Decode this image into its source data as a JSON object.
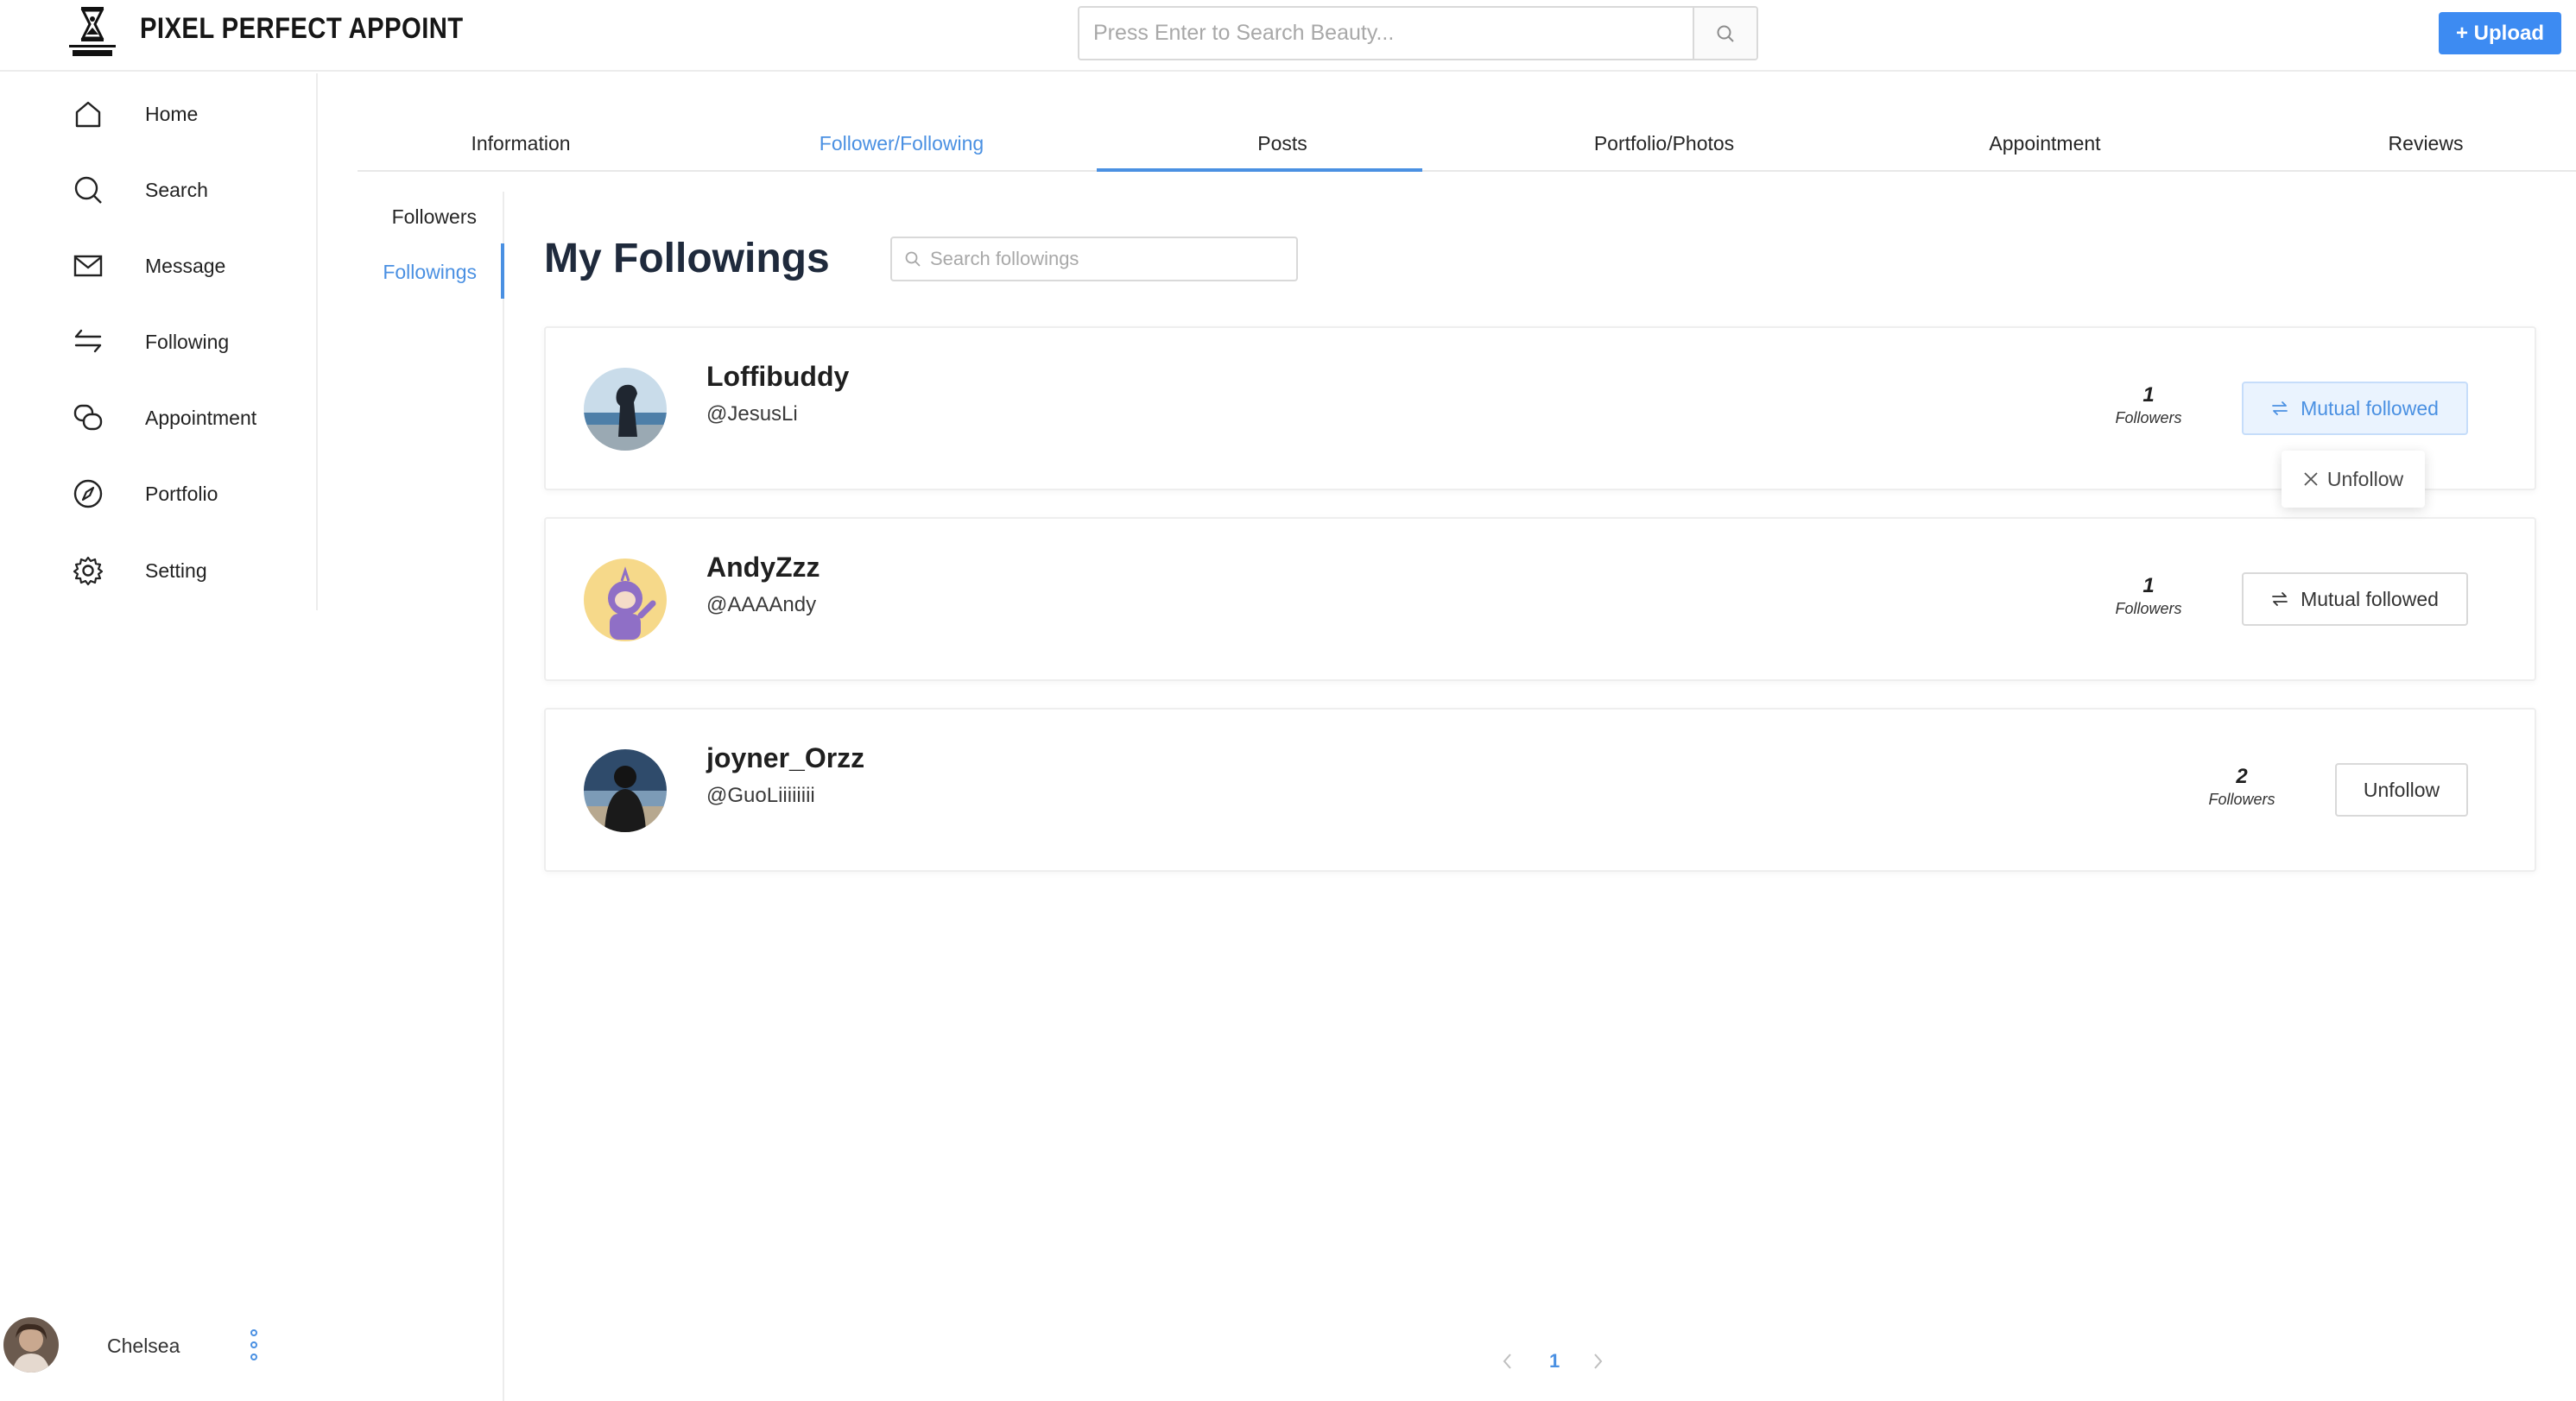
{
  "brand": {
    "name": "PIXEL PERFECT APPOINT"
  },
  "header": {
    "search_placeholder": "Press Enter to Search Beauty...",
    "upload_label": "+ Upload"
  },
  "sidebar": {
    "items": [
      {
        "label": "Home",
        "icon": "home-icon"
      },
      {
        "label": "Search",
        "icon": "search-icon"
      },
      {
        "label": "Message",
        "icon": "mail-icon"
      },
      {
        "label": "Following",
        "icon": "swap-icon"
      },
      {
        "label": "Appointment",
        "icon": "chat-bubbles-icon"
      },
      {
        "label": "Portfolio",
        "icon": "compass-icon"
      },
      {
        "label": "Setting",
        "icon": "gear-icon"
      }
    ],
    "user": {
      "name": "Chelsea"
    }
  },
  "tabs": {
    "items": [
      "Information",
      "Follower/Following",
      "Posts",
      "Portfolio/Photos",
      "Appointment",
      "Reviews"
    ],
    "active": "Follower/Following"
  },
  "submenu": {
    "items": [
      "Followers",
      "Followings"
    ],
    "active": "Followings"
  },
  "main": {
    "title": "My Followings",
    "search_placeholder": "Search followings",
    "followers_unit": "Followers",
    "users": [
      {
        "name": "Loffibuddy",
        "handle": "@JesusLi",
        "followers": "1",
        "action": "Mutual followed"
      },
      {
        "name": "AndyZzz",
        "handle": "@AAAAndy",
        "followers": "1",
        "action": "Mutual followed"
      },
      {
        "name": "joyner_Orzz",
        "handle": "@GuoLiiiiiiii",
        "followers": "2",
        "action": "Unfollow"
      }
    ],
    "dropdown_label": "Unfollow"
  },
  "pagination": {
    "current": "1"
  },
  "colors": {
    "accent": "#4a90e2",
    "upload": "#3d8bf2",
    "title": "#1f2a3c"
  }
}
